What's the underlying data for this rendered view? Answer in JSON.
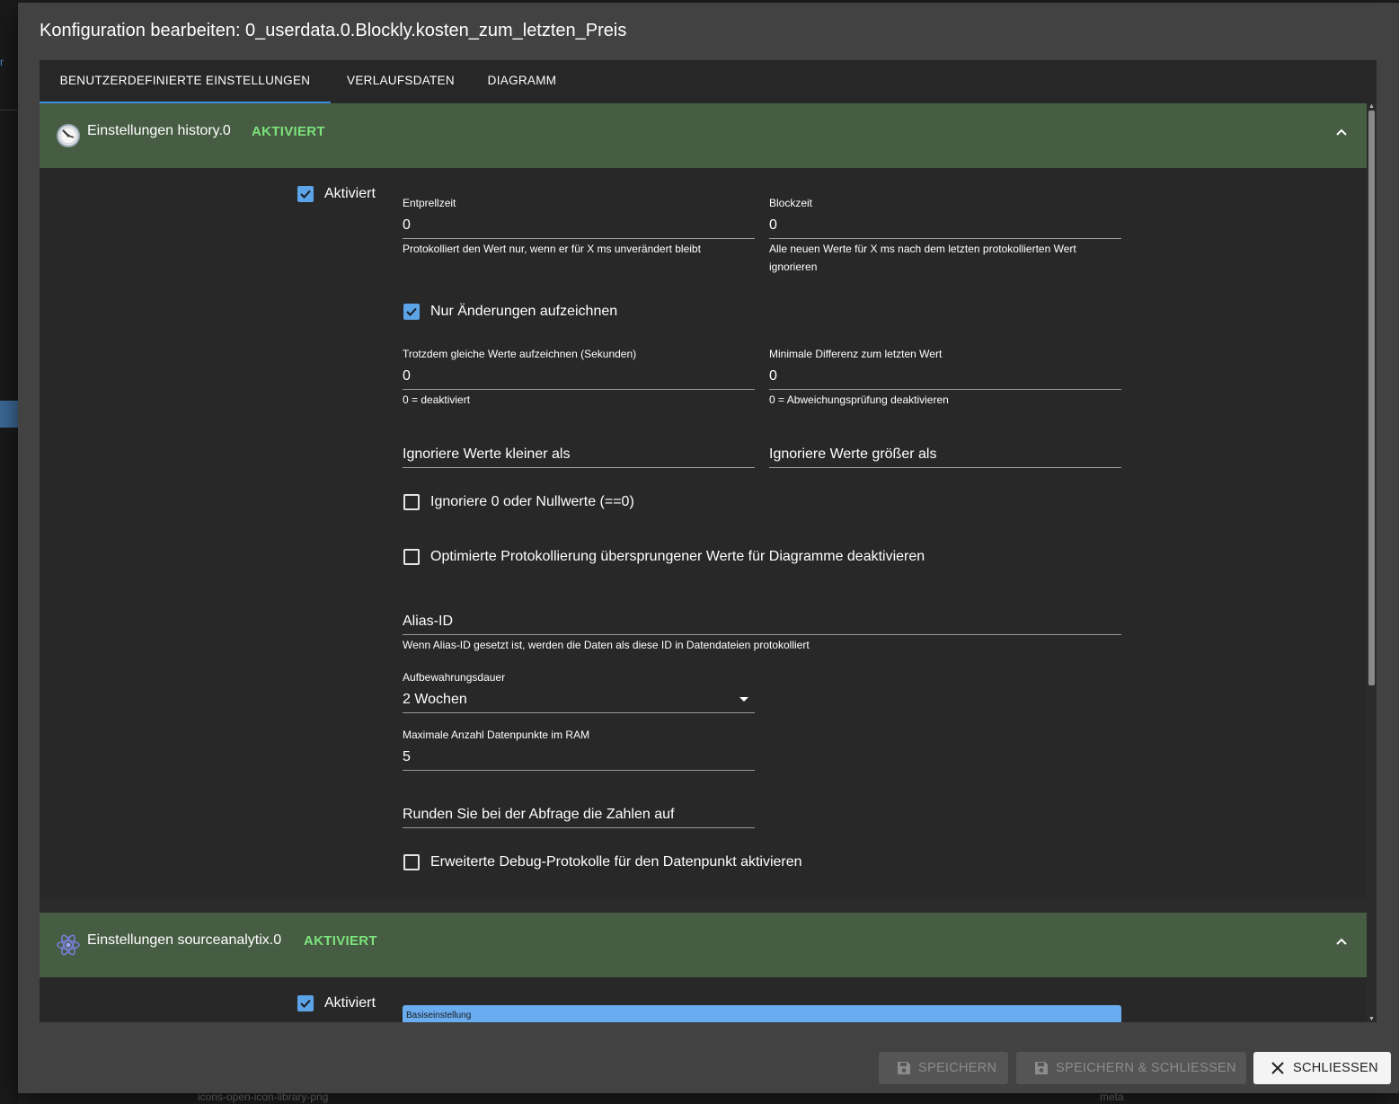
{
  "dialog": {
    "title": "Konfiguration bearbeiten: 0_userdata.0.Blockly.kosten_zum_letzten_Preis"
  },
  "tabs": [
    {
      "label": "BENUTZERDEFINIERTE EINSTELLUNGEN",
      "active": true
    },
    {
      "label": "VERLAUFSDATEN",
      "active": false
    },
    {
      "label": "DIAGRAMM",
      "active": false
    }
  ],
  "history_panel": {
    "title": "Einstellungen history.0",
    "status": "AKTIVIERT",
    "enabled_label": "Aktiviert",
    "enabled": true,
    "entprellzeit": {
      "label": "Entprellzeit",
      "value": "0",
      "help": "Protokolliert den Wert nur, wenn er für X ms unverändert bleibt"
    },
    "blockzeit": {
      "label": "Blockzeit",
      "value": "0",
      "help_line1": "Alle neuen Werte für X ms nach dem letzten protokollierten Wert",
      "help_line2": "ignorieren"
    },
    "nur_aenderungen": {
      "label": "Nur Änderungen aufzeichnen",
      "checked": true
    },
    "trotzdem": {
      "label": "Trotzdem gleiche Werte aufzeichnen (Sekunden)",
      "value": "0",
      "help": "0 = deaktiviert"
    },
    "min_diff": {
      "label": "Minimale Differenz zum letzten Wert",
      "value": "0",
      "help": "0 = Abweichungsprüfung deaktivieren"
    },
    "ignore_lower": {
      "placeholder": "Ignoriere Werte kleiner als"
    },
    "ignore_higher": {
      "placeholder": "Ignoriere Werte größer als"
    },
    "ignore_zero": {
      "label": "Ignoriere 0 oder Nullwerte (==0)",
      "checked": false
    },
    "disable_skipped": {
      "label": "Optimierte Protokollierung übersprungener Werte für Diagramme deaktivieren",
      "checked": false
    },
    "alias": {
      "placeholder": "Alias-ID",
      "help": "Wenn Alias-ID gesetzt ist, werden die Daten als diese ID in Datendateien protokolliert"
    },
    "retention": {
      "label": "Aufbewahrungsdauer",
      "value": "2 Wochen"
    },
    "max_ram": {
      "label": "Maximale Anzahl Datenpunkte im RAM",
      "value": "5"
    },
    "round": {
      "placeholder": "Runden Sie bei der Abfrage die Zahlen auf"
    },
    "debug": {
      "label": "Erweiterte Debug-Protokolle für den Datenpunkt aktivieren",
      "checked": false
    }
  },
  "sourceanalytix_panel": {
    "title": "Einstellungen sourceanalytix.0",
    "status": "AKTIVIERT",
    "enabled_label": "Aktiviert",
    "enabled": true,
    "basis_label": "Basiseinstellung"
  },
  "buttons": {
    "save": "SPEICHERN",
    "save_close": "SPEICHERN & SCHLIESSEN",
    "close": "SCHLIESSEN"
  },
  "background": {
    "bottom_text_left": "icons-open-icon-library-png",
    "bottom_text_right": "meta"
  },
  "colors": {
    "accent": "#5ca4e8",
    "panel_header": "#465c43",
    "status_green": "#7de37b"
  }
}
